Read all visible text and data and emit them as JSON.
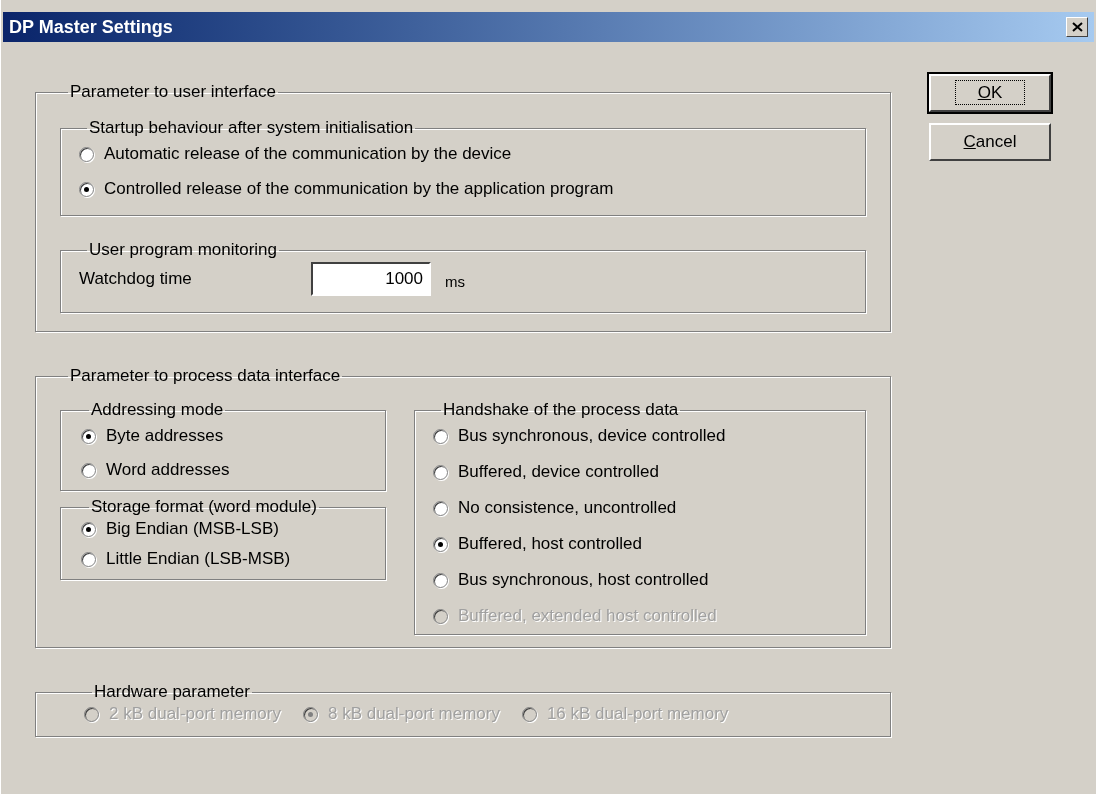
{
  "window": {
    "title": "DP Master Settings"
  },
  "buttons": [
    {
      "label": "OK",
      "default": true
    },
    {
      "label": "Cancel",
      "default": false
    }
  ],
  "user_interface": {
    "title": "Parameter to user interface",
    "startup": {
      "title": "Startup behaviour after system initialisation",
      "options": [
        {
          "label": "Automatic release of the communication by the device",
          "selected": false
        },
        {
          "label": "Controlled release of the communication by the application program",
          "selected": true
        }
      ]
    },
    "monitoring": {
      "title": "User program monitoring",
      "label": "Watchdog time",
      "value": "1000",
      "unit": "ms"
    }
  },
  "process_data": {
    "title": "Parameter to process data interface",
    "addressing": {
      "title": "Addressing mode",
      "options": [
        {
          "label": "Byte addresses",
          "selected": true
        },
        {
          "label": "Word addresses",
          "selected": false
        }
      ]
    },
    "storage": {
      "title": "Storage format (word module)",
      "options": [
        {
          "label": "Big Endian (MSB-LSB)",
          "selected": true
        },
        {
          "label": "Little Endian (LSB-MSB)",
          "selected": false
        }
      ]
    },
    "handshake": {
      "title": "Handshake of the process data",
      "options": [
        {
          "label": "Bus synchronous, device controlled",
          "selected": false,
          "disabled": false
        },
        {
          "label": "Buffered, device controlled",
          "selected": false,
          "disabled": false
        },
        {
          "label": "No consistence, uncontrolled",
          "selected": false,
          "disabled": false
        },
        {
          "label": "Buffered, host controlled",
          "selected": true,
          "disabled": false
        },
        {
          "label": "Bus synchronous, host controlled",
          "selected": false,
          "disabled": false
        },
        {
          "label": "Buffered, extended host controlled",
          "selected": false,
          "disabled": true
        }
      ]
    }
  },
  "hardware": {
    "title": "Hardware parameter",
    "options": [
      {
        "label": "2 kB dual-port memory",
        "selected": false,
        "disabled": true
      },
      {
        "label": "8 kB dual-port memory",
        "selected": true,
        "disabled": true
      },
      {
        "label": "16 kB dual-port memory",
        "selected": false,
        "disabled": true
      }
    ]
  }
}
